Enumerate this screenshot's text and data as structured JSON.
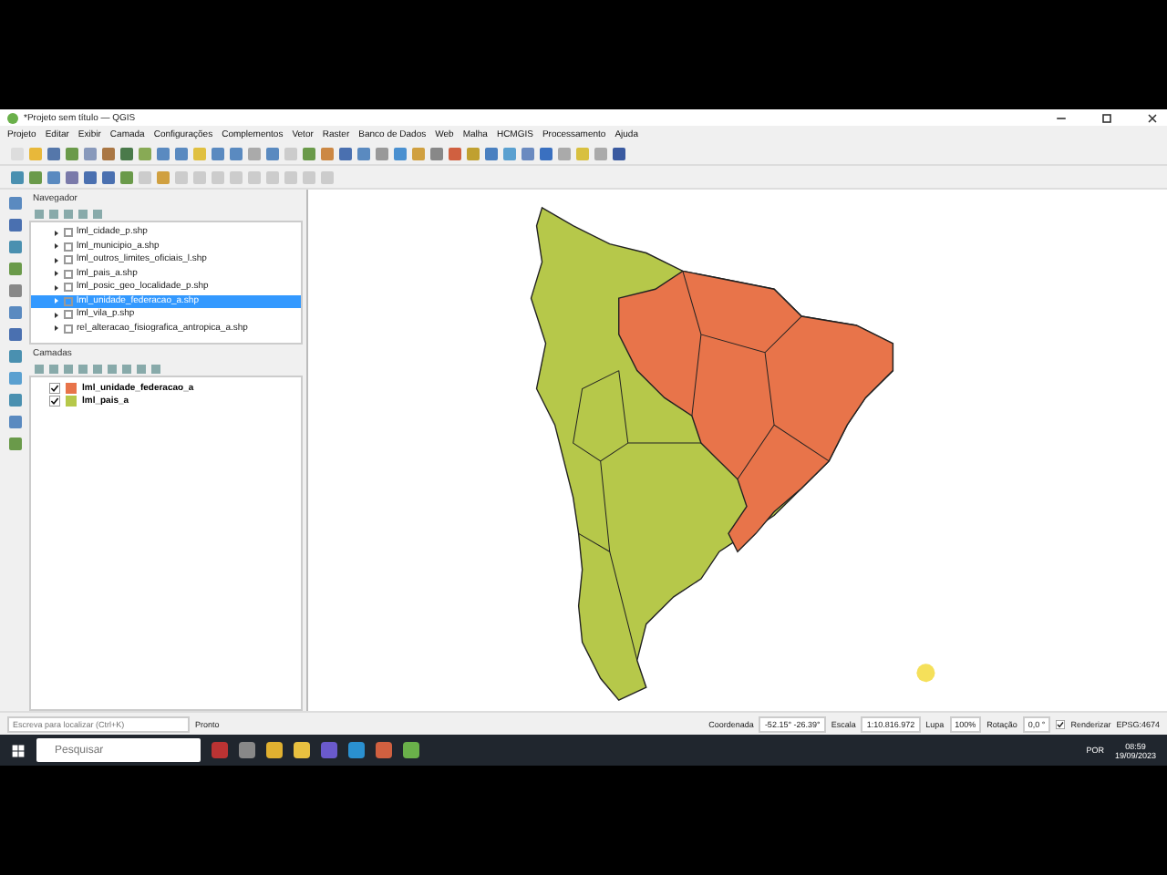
{
  "window": {
    "title": "*Projeto sem título — QGIS"
  },
  "menu": [
    "Projeto",
    "Editar",
    "Exibir",
    "Camada",
    "Configurações",
    "Complementos",
    "Vetor",
    "Raster",
    "Banco de Dados",
    "Web",
    "Malha",
    "HCMGIS",
    "Processamento",
    "Ajuda"
  ],
  "navigator": {
    "title": "Navegador",
    "items": [
      {
        "label": "lml_cidade_p.shp",
        "selected": false
      },
      {
        "label": "lml_municipio_a.shp",
        "selected": false
      },
      {
        "label": "lml_outros_limites_oficiais_l.shp",
        "selected": false
      },
      {
        "label": "lml_pais_a.shp",
        "selected": false
      },
      {
        "label": "lml_posic_geo_localidade_p.shp",
        "selected": false
      },
      {
        "label": "lml_unidade_federacao_a.shp",
        "selected": true
      },
      {
        "label": "lml_vila_p.shp",
        "selected": false
      },
      {
        "label": "rel_alteracao_fisiografica_antropica_a.shp",
        "selected": false
      }
    ]
  },
  "layers": {
    "title": "Camadas",
    "items": [
      {
        "label": "lml_unidade_federacao_a",
        "checked": true,
        "color": "#e8744a"
      },
      {
        "label": "lml_pais_a",
        "checked": true,
        "color": "#b6c84a"
      }
    ]
  },
  "status_bar": {
    "locator_placeholder": "Escreva para localizar (Ctrl+K)",
    "message": "Pronto",
    "coordinate_label": "Coordenada",
    "coordinate": "-52.15° -26.39°",
    "scale_label": "Escala",
    "scale": "1:10.816.972",
    "magnifier_label": "Lupa",
    "magnifier": "100%",
    "rotation_label": "Rotação",
    "rotation": "0,0 °",
    "render_label": "Renderizar",
    "render_checked": true,
    "crs": "EPSG:4674"
  },
  "taskbar": {
    "search_placeholder": "Pesquisar",
    "language": "POR",
    "time": "08:59",
    "date": "19/09/2023"
  }
}
